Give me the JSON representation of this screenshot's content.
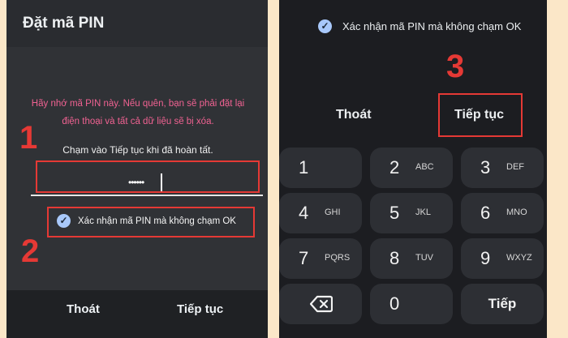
{
  "left": {
    "title": "Đặt mã PIN",
    "warning_line1": "Hãy nhớ mã PIN này. Nếu quên, bạn sẽ phải đặt lại",
    "warning_line2": "điện thoại và tất cả dữ liệu sẽ bị xóa.",
    "hint": "Chạm vào Tiếp tục khi đã hoàn tất.",
    "pin_value": "••••••",
    "confirm_label": "Xác nhận mã PIN mà không chạm OK",
    "exit_label": "Thoát",
    "next_label": "Tiếp tục",
    "step1": "1",
    "step2": "2"
  },
  "right": {
    "confirm_label": "Xác nhận mã PIN mà không chạm OK",
    "step3": "3",
    "exit_label": "Thoát",
    "next_label": "Tiếp tục",
    "keys": [
      {
        "num": "1",
        "letters": ""
      },
      {
        "num": "2",
        "letters": "ABC"
      },
      {
        "num": "3",
        "letters": "DEF"
      },
      {
        "num": "4",
        "letters": "GHI"
      },
      {
        "num": "5",
        "letters": "JKL"
      },
      {
        "num": "6",
        "letters": "MNO"
      },
      {
        "num": "7",
        "letters": "PQRS"
      },
      {
        "num": "8",
        "letters": "TUV"
      },
      {
        "num": "9",
        "letters": "WXYZ"
      },
      {
        "num": "0",
        "letters": ""
      }
    ],
    "enter_label": "Tiếp"
  },
  "colors": {
    "accent_red": "#e53935",
    "warning_pink": "#f06292",
    "check_blue": "#a8c8fa"
  },
  "icons": {
    "checkbox": "check-circle-icon",
    "backspace": "backspace-icon"
  }
}
